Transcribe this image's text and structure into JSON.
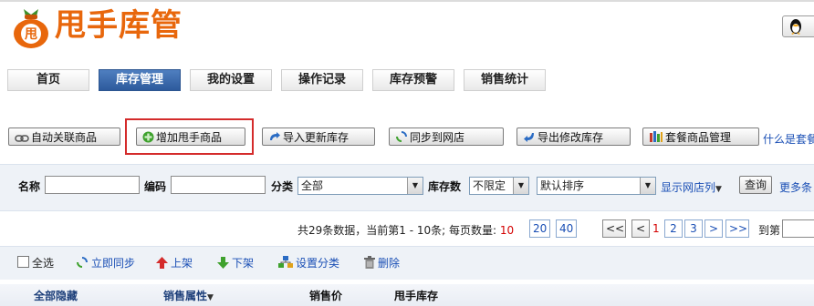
{
  "app": {
    "title": "甩手库管",
    "logo_glyph": "甩"
  },
  "nav": {
    "tabs": [
      {
        "label": "首页",
        "active": false
      },
      {
        "label": "库存管理",
        "active": true
      },
      {
        "label": "我的设置",
        "active": false
      },
      {
        "label": "操作记录",
        "active": false
      },
      {
        "label": "库存预警",
        "active": false
      },
      {
        "label": "销售统计",
        "active": false
      }
    ]
  },
  "actions": {
    "auto_link": "自动关联商品",
    "add_product": "增加甩手商品",
    "import_update": "导入更新库存",
    "sync_shop": "同步到网店",
    "export_modify": "导出修改库存",
    "bundle_manage": "套餐商品管理",
    "help_link": "什么是套餐"
  },
  "filters": {
    "name_label": "名称",
    "name_value": "",
    "code_label": "编码",
    "code_value": "",
    "category_label": "分类",
    "category_value": "全部",
    "stock_label": "库存数",
    "stock_value": "不限定",
    "sort_value": "默认排序",
    "show_shop_columns": "显示网店列",
    "query_button": "查询",
    "more_filters": "更多条"
  },
  "pagination": {
    "summary_prefix": "共29条数据，当前第1 - 10条; 每页数量:",
    "page_sizes": [
      "10",
      "20",
      "40"
    ],
    "first": "<<",
    "prev": "<",
    "pages": [
      "1",
      "2",
      "3"
    ],
    "next": ">",
    "last": ">>",
    "goto_label": "到第"
  },
  "toolbar": {
    "select_all": "全选",
    "sync_now": "立即同步",
    "on_shelf": "上架",
    "off_shelf": "下架",
    "set_category": "设置分类",
    "delete": "删除"
  },
  "table": {
    "headers": [
      "全部隐藏",
      "销售属性",
      "销售价",
      "甩手库存"
    ]
  },
  "colors": {
    "brand": "#e8670c",
    "accent": "#2d5a9c",
    "link": "#1a4fb5",
    "highlight": "#d42b2b"
  }
}
